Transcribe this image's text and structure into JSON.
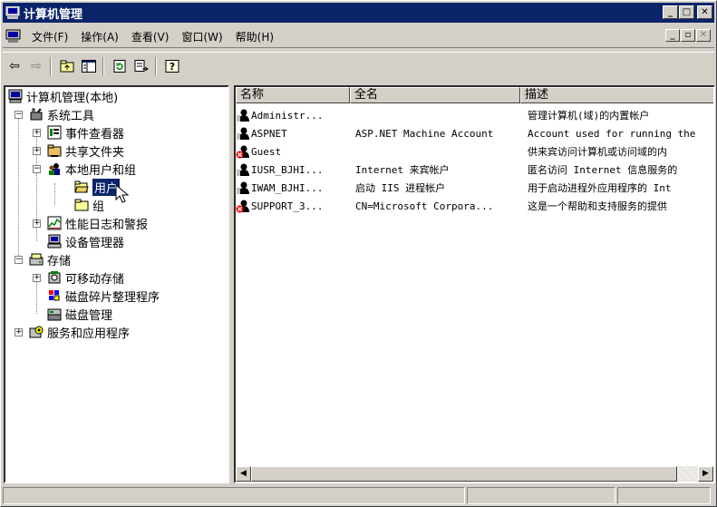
{
  "window": {
    "title": "计算机管理"
  },
  "menu": {
    "items": [
      "文件(F)",
      "操作(A)",
      "查看(V)",
      "窗口(W)",
      "帮助(H)"
    ]
  },
  "tree": {
    "root": "计算机管理(本地)",
    "system_tools": "系统工具",
    "event_viewer": "事件查看器",
    "shared_folders": "共享文件夹",
    "local_users_groups": "本地用户和组",
    "users": "用户",
    "groups": "组",
    "perf_logs": "性能日志和警报",
    "device_manager": "设备管理器",
    "storage": "存储",
    "removable_storage": "可移动存储",
    "defrag": "磁盘碎片整理程序",
    "disk_management": "磁盘管理",
    "services_apps": "服务和应用程序"
  },
  "list": {
    "columns": [
      "名称",
      "全名",
      "描述"
    ],
    "rows": [
      {
        "name": "Administr...",
        "fullname": "",
        "desc": "管理计算机(域)的内置帐户",
        "disabled": false
      },
      {
        "name": "ASPNET",
        "fullname": "ASP.NET Machine Account",
        "desc": "Account used for running the",
        "disabled": false
      },
      {
        "name": "Guest",
        "fullname": "",
        "desc": "供来宾访问计算机或访问域的内",
        "disabled": true
      },
      {
        "name": "IUSR_BJHI...",
        "fullname": "Internet 来宾帐户",
        "desc": "匿名访问 Internet 信息服务的",
        "disabled": false
      },
      {
        "name": "IWAM_BJHI...",
        "fullname": "启动 IIS 进程帐户",
        "desc": "用于启动进程外应用程序的 Int",
        "disabled": false
      },
      {
        "name": "SUPPORT_3...",
        "fullname": "CN=Microsoft Corpora...",
        "desc": "这是一个帮助和支持服务的提供",
        "disabled": true
      }
    ]
  },
  "colors": {
    "title_bar": "#0a246a",
    "selection": "#0a246a",
    "face": "#d4d0c8"
  }
}
